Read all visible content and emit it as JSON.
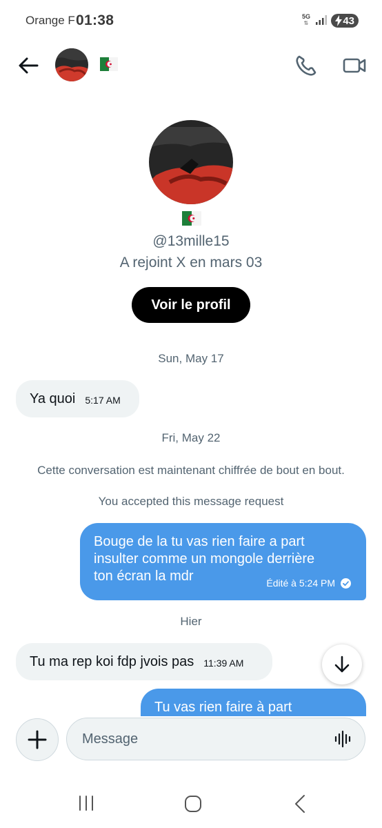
{
  "status_bar": {
    "carrier": "Orange F",
    "time": "01:38",
    "network": "5G",
    "battery": "43"
  },
  "header": {
    "flag_icon": "algeria-flag-icon",
    "call_icon": "phone-icon",
    "video_icon": "video-camera-icon",
    "back_icon": "arrow-left-icon"
  },
  "profile": {
    "handle": "@13mille15",
    "joined": "A rejoint X en mars 03",
    "view_profile_label": "Voir le profil"
  },
  "messages": {
    "date1": "Sun, May 17",
    "msg1_text": "Ya quoi",
    "msg1_time": "5:17 AM",
    "date2": "Fri, May 22",
    "encryption_notice": "Cette conversation est maintenant chiffrée de bout en bout.",
    "request_notice": "You accepted this message request",
    "msg2_lines": [
      "Bouge de la tu vas rien faire a part",
      "insulter comme un mongole derrière",
      "ton écran la mdr"
    ],
    "msg2_meta": "Édité à 5:24 PM",
    "date3": "Hier",
    "msg3_text": "Tu ma rep koi fdp jvois pas",
    "msg3_time": "11:39 AM",
    "msg4_partial": "Tu vas rien faire à part"
  },
  "composer": {
    "placeholder": "Message"
  },
  "colors": {
    "accent": "#4a99e9",
    "bubble_in": "#eff3f4",
    "muted": "#536471"
  }
}
